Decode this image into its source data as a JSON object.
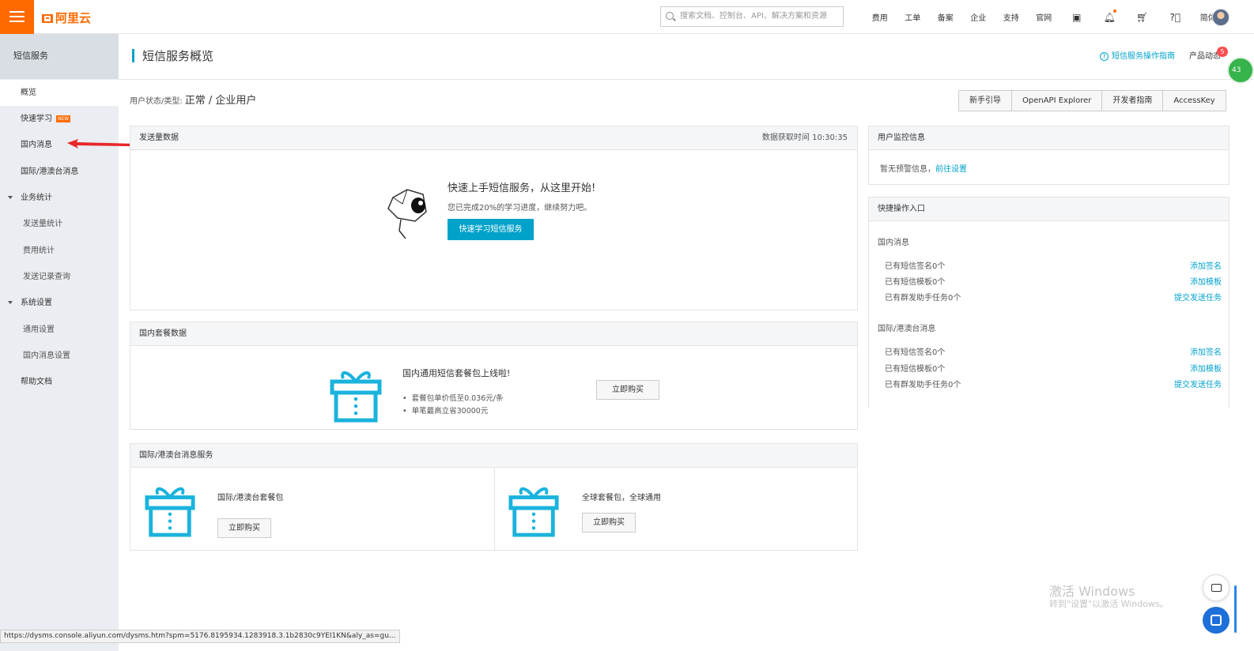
{
  "topbar": {
    "logo_text": "阿里云",
    "search_placeholder": "搜索文档、控制台、API、解决方案和资源",
    "nav": [
      "费用",
      "工单",
      "备案",
      "企业",
      "支持",
      "官网"
    ],
    "lang_label": "简体"
  },
  "sidebar": {
    "title": "短信服务",
    "items": [
      {
        "label": "概览"
      },
      {
        "label": "快速学习",
        "badge": "NEW"
      },
      {
        "label": "国内消息"
      },
      {
        "label": "国际/港澳台消息"
      },
      {
        "label": "业务统计"
      },
      {
        "label": "发送量统计"
      },
      {
        "label": "费用统计"
      },
      {
        "label": "发送记录查询"
      },
      {
        "label": "系统设置"
      },
      {
        "label": "通用设置"
      },
      {
        "label": "国内消息设置"
      },
      {
        "label": "帮助文档"
      }
    ]
  },
  "page": {
    "title": "短信服务概览",
    "guide_link": "短信服务操作指南",
    "product_news": "产品动态",
    "news_count": "5",
    "float_label": "43",
    "user_status_label": "用户状态/类型:",
    "user_status_value": "正常 / 企业用户",
    "buttons": [
      "新手引导",
      "OpenAPI Explorer",
      "开发者指南",
      "AccessKey"
    ]
  },
  "send_panel": {
    "title": "发送量数据",
    "time_label": "数据获取时间 10:30:35",
    "quick_title": "快速上手短信服务，从这里开始!",
    "quick_sub": "您已完成20%的学习进度，继续努力吧。",
    "quick_button": "快速学习短信服务"
  },
  "domestic_panel": {
    "title": "国内套餐数据",
    "promo_title": "国内通用短信套餐包上线啦!",
    "bullets": [
      "套餐包单价低至0.036元/条",
      "单笔最高立省30000元"
    ],
    "buy_button": "立即购买"
  },
  "intl_panel": {
    "title": "国际/港澳台消息服务",
    "left_text": "国际/港澳台套餐包",
    "left_button": "立即购买",
    "right_text": "全球套餐包，全球通用",
    "right_button": "立即购买"
  },
  "monitor_panel": {
    "title": "用户监控信息",
    "text": "暂无预警信息，",
    "link": "前往设置"
  },
  "quick_entry": {
    "title": "快捷操作入口",
    "domestic_label": "国内消息",
    "domestic_rows": [
      {
        "text": "已有短信签名0个",
        "link": "添加签名"
      },
      {
        "text": "已有短信模板0个",
        "link": "添加模板"
      },
      {
        "text": "已有群发助手任务0个",
        "link": "提交发送任务"
      }
    ],
    "intl_label": "国际/港澳台消息",
    "intl_rows": [
      {
        "text": "已有短信签名0个",
        "link": "添加签名"
      },
      {
        "text": "已有短信模板0个",
        "link": "添加模板"
      },
      {
        "text": "已有群发助手任务0个",
        "link": "提交发送任务"
      }
    ]
  },
  "watermark": {
    "line1": "激活 Windows",
    "line2": "转到\"设置\"以激活 Windows。"
  },
  "status_url": "https://dysms.console.aliyun.com/dysms.htm?spm=5176.8195934.1283918.3.1b2830c9YEI1KN&aly_as=gu...",
  "colors": {
    "brand": "#ff6a00",
    "accent": "#00a2ca",
    "annotation_arrow": "#e8262a"
  }
}
